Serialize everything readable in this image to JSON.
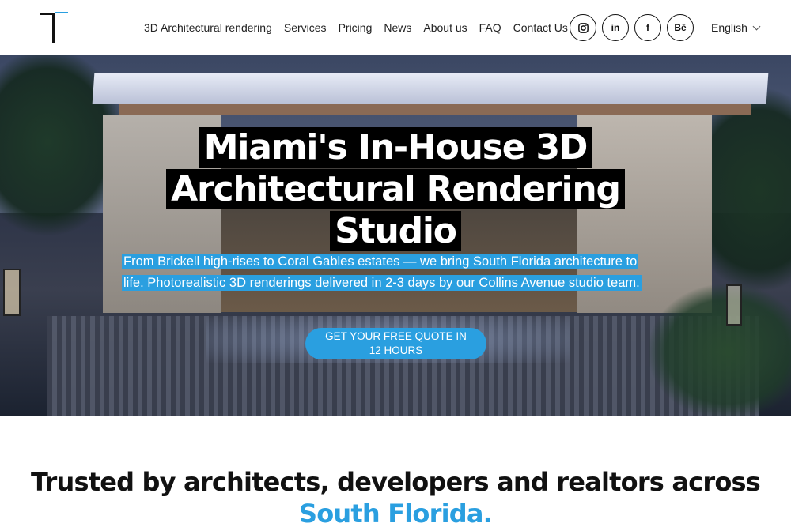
{
  "nav": {
    "items": [
      {
        "label": "3D Architectural rendering",
        "active": true
      },
      {
        "label": "Services"
      },
      {
        "label": "Pricing"
      },
      {
        "label": "News"
      },
      {
        "label": "About us"
      },
      {
        "label": "FAQ"
      },
      {
        "label": "Contact Us"
      }
    ]
  },
  "socials": [
    {
      "name": "instagram-icon"
    },
    {
      "name": "linkedin-icon",
      "text": "in"
    },
    {
      "name": "facebook-icon",
      "text": "f"
    },
    {
      "name": "behance-icon",
      "text": "Bē"
    }
  ],
  "language": {
    "selected": "English"
  },
  "hero": {
    "title_lines": [
      "Miami's In-House 3D",
      "Architectural Rendering",
      "Studio"
    ],
    "subtitle": "From Brickell high-rises to Coral Gables estates — we bring South Florida architecture to life. Photorealistic 3D renderings delivered in 2-3 days by our Collins Avenue studio team.",
    "cta_label": "GET YOUR FREE QUOTE IN 12 HOURS"
  },
  "trust": {
    "heading_main": "Trusted by architects, developers and realtors across ",
    "heading_accent": "South Florida."
  },
  "colors": {
    "accent": "#2a9fe0",
    "text": "#111111",
    "background": "#ffffff"
  }
}
